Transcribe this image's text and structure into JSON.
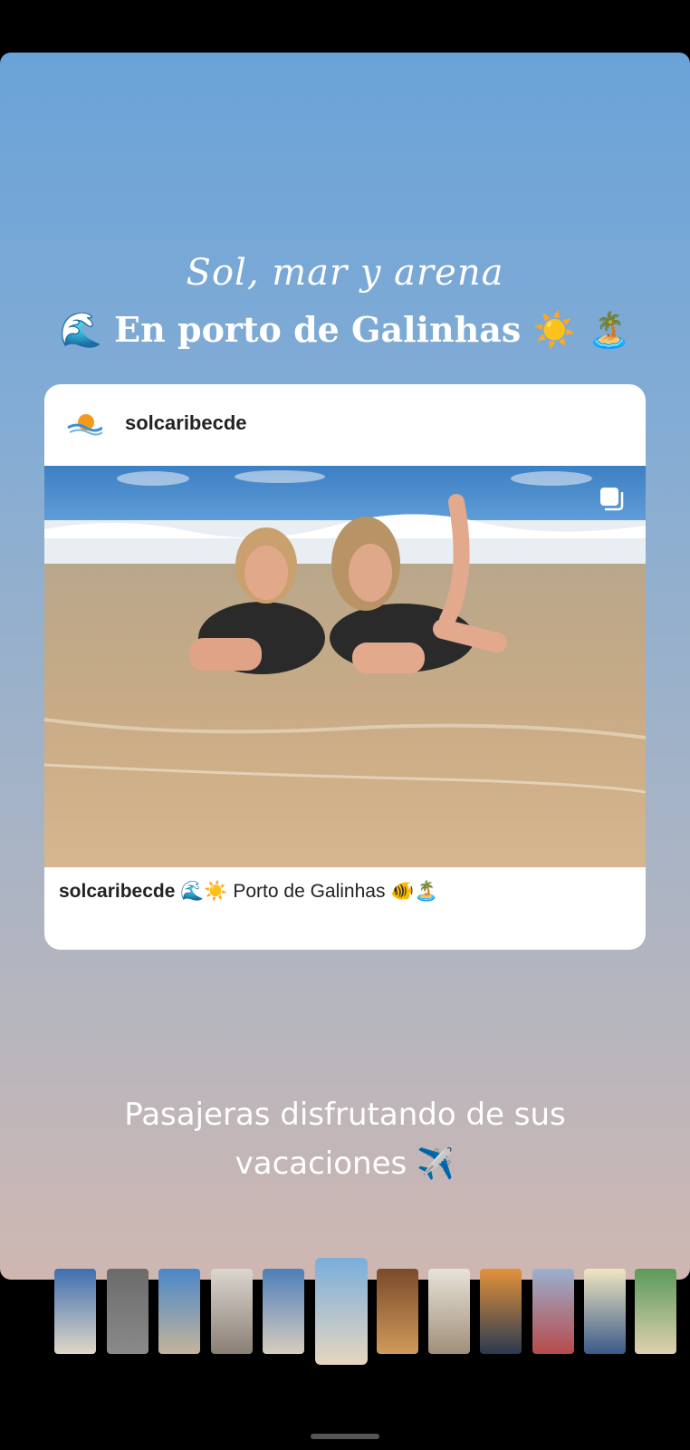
{
  "story": {
    "title_line1": "Sol, mar y arena",
    "title_line2": "🌊 En porto de Galinhas ☀️ 🏝️",
    "bottom_line1": "Pasajeras disfrutando de sus",
    "bottom_line2": "vacaciones ✈️"
  },
  "post": {
    "username": "solcaribecde",
    "caption_user": "solcaribecde",
    "caption_text": " 🌊☀️ Porto de Galinhas 🐠🏝️",
    "multi_icon": "carousel-icon"
  },
  "thumbnails": [
    {
      "name": "thumb-1",
      "colors": [
        "#3e6fb0",
        "#e0d7c7"
      ]
    },
    {
      "name": "thumb-2",
      "colors": [
        "#6b6b6b",
        "#8a8a8a"
      ]
    },
    {
      "name": "thumb-3",
      "colors": [
        "#4a87c9",
        "#c4b49a"
      ]
    },
    {
      "name": "thumb-4",
      "colors": [
        "#dcd6cf",
        "#8a7f75"
      ]
    },
    {
      "name": "thumb-5",
      "colors": [
        "#4d7fb8",
        "#d8cdbf"
      ]
    },
    {
      "name": "thumb-6",
      "colors": [
        "#7aaedc",
        "#e6d6bf"
      ]
    },
    {
      "name": "thumb-7",
      "colors": [
        "#7a4a2a",
        "#d09a5a"
      ]
    },
    {
      "name": "thumb-8",
      "colors": [
        "#e8e2d8",
        "#a08f7a"
      ]
    },
    {
      "name": "thumb-9",
      "colors": [
        "#e4923a",
        "#2a3a50"
      ]
    },
    {
      "name": "thumb-10",
      "colors": [
        "#9ab0d0",
        "#b84a4a"
      ]
    },
    {
      "name": "thumb-11",
      "colors": [
        "#f0e6c0",
        "#3a5a8a"
      ]
    },
    {
      "name": "thumb-12",
      "colors": [
        "#5a9a5a",
        "#e0d0b0"
      ]
    }
  ]
}
